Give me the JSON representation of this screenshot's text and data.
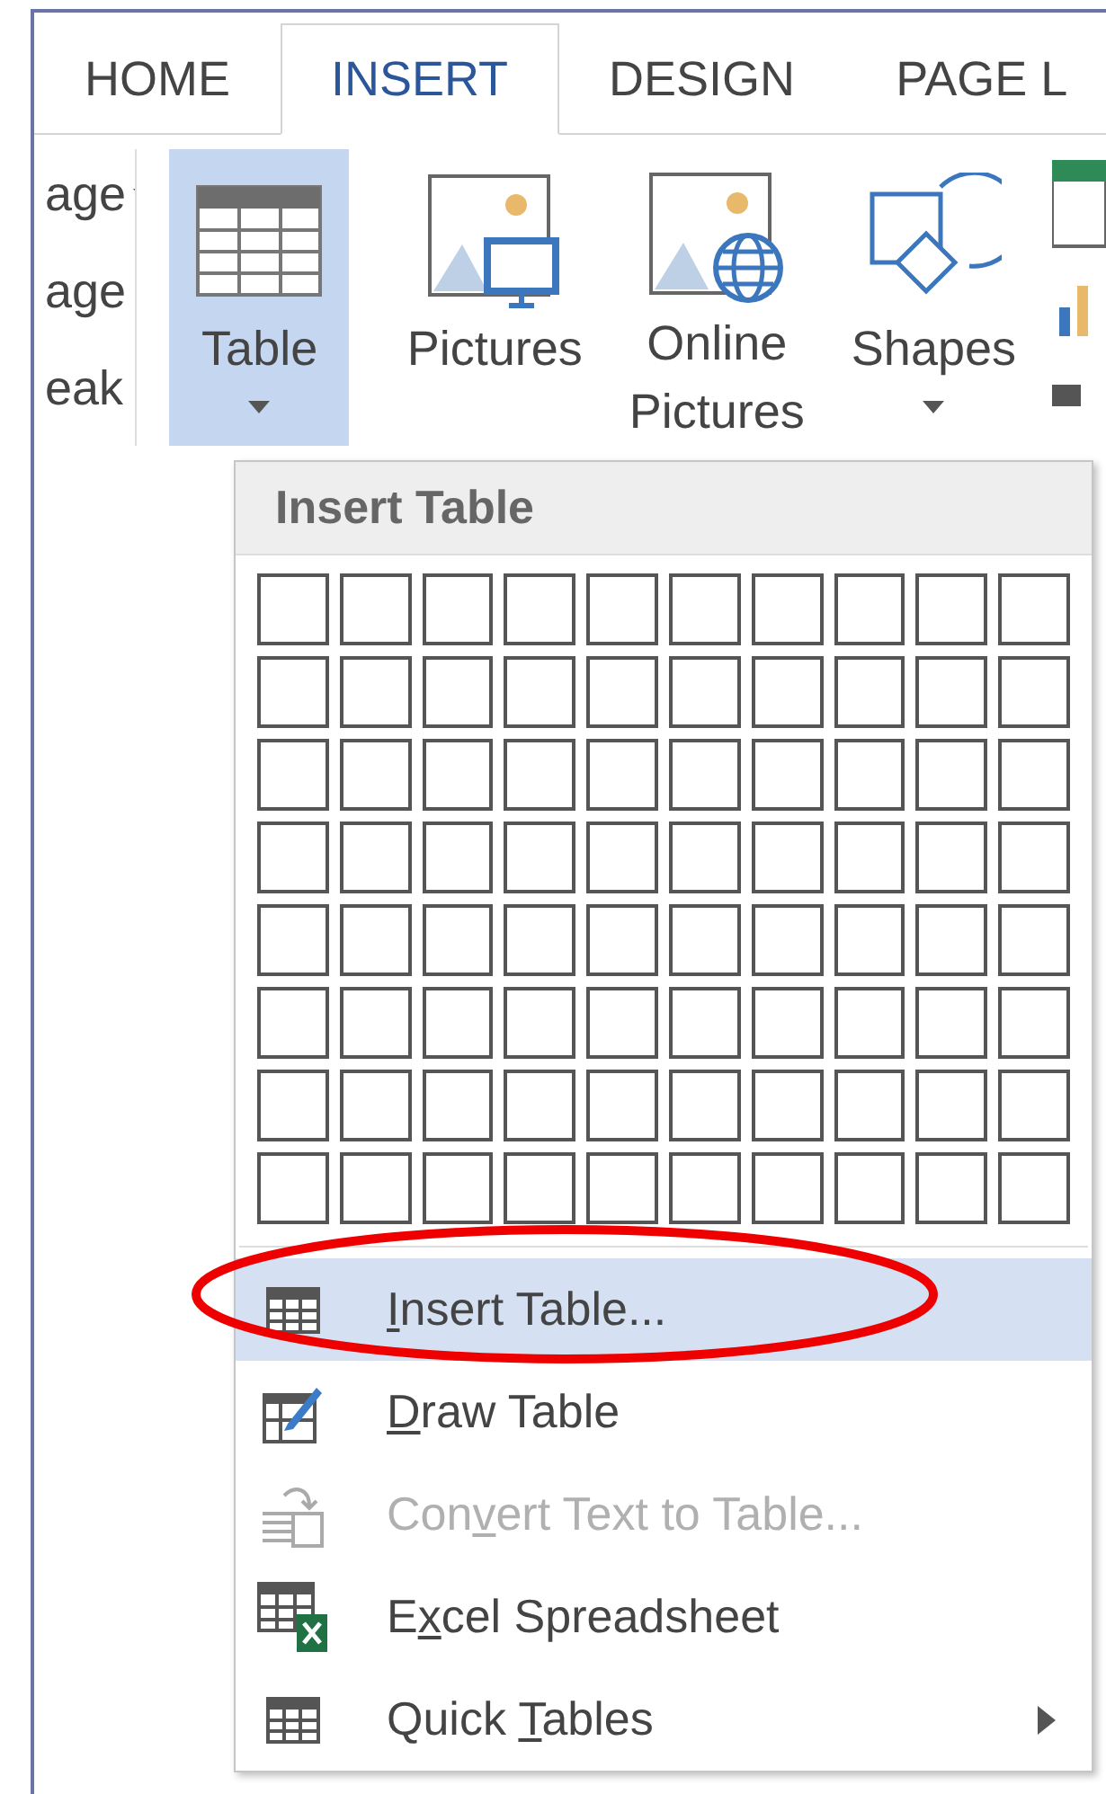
{
  "tabs": [
    {
      "label": "HOME",
      "selected": false
    },
    {
      "label": "INSERT",
      "selected": true
    },
    {
      "label": "DESIGN",
      "selected": false
    },
    {
      "label": "PAGE L",
      "selected": false
    }
  ],
  "ribbon_left": [
    "age",
    "age",
    "eak"
  ],
  "ribbon_buttons": [
    {
      "kind": "table",
      "lines": [
        "Table"
      ],
      "dropdown": true,
      "selected": true
    },
    {
      "kind": "pictures",
      "lines": [
        "Pictures"
      ],
      "dropdown": false,
      "selected": false
    },
    {
      "kind": "online",
      "lines": [
        "Online",
        "Pictures"
      ],
      "dropdown": false,
      "selected": false
    },
    {
      "kind": "shapes",
      "lines": [
        "Shapes"
      ],
      "dropdown": true,
      "selected": false
    }
  ],
  "menu": {
    "title": "Insert Table",
    "items": [
      {
        "kind": "insert",
        "key": "I",
        "post": "nsert Table...",
        "selected": true,
        "disabled": false,
        "submenu": false
      },
      {
        "kind": "draw",
        "key": "D",
        "post": "raw Table",
        "selected": false,
        "disabled": false,
        "submenu": false
      },
      {
        "kind": "convert",
        "pre": "Con",
        "key": "v",
        "post": "ert Text to Table...",
        "selected": false,
        "disabled": true,
        "submenu": false
      },
      {
        "kind": "excel",
        "pre": "E",
        "key": "x",
        "post": "cel Spreadsheet",
        "selected": false,
        "disabled": false,
        "submenu": false
      },
      {
        "kind": "quick",
        "pre": "Quick ",
        "key": "T",
        "post": "ables",
        "selected": false,
        "disabled": false,
        "submenu": true
      }
    ]
  }
}
